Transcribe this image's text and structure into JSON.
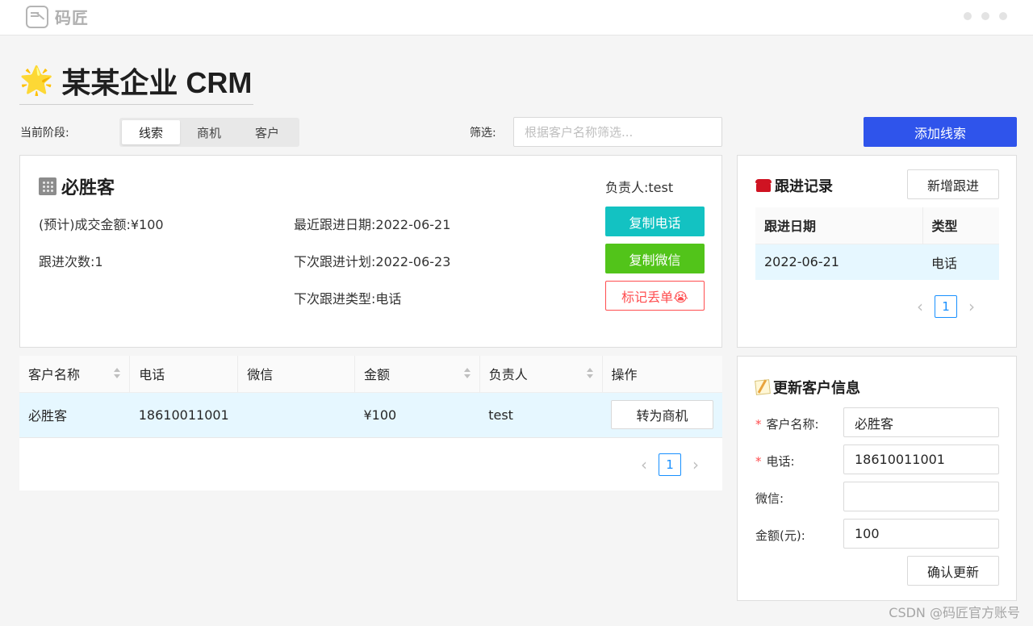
{
  "app": {
    "logo_text": "码匠"
  },
  "page": {
    "title": "某某企业 CRM"
  },
  "stage_filter": {
    "label": "当前阶段:",
    "tabs": [
      {
        "label": "线索",
        "active": true
      },
      {
        "label": "商机",
        "active": false
      },
      {
        "label": "客户",
        "active": false
      }
    ]
  },
  "search": {
    "label": "筛选:",
    "placeholder": "根据客户名称筛选...",
    "value": ""
  },
  "add_lead_button": "添加线索",
  "detail": {
    "company": "必胜客",
    "owner": "负责人:test",
    "expected_amount": "(预计)成交金额:¥100",
    "followup_count": "跟进次数:1",
    "last_followup": "最近跟进日期:2022-06-21",
    "next_plan": "下次跟进计划:2022-06-23",
    "next_type": "下次跟进类型:电话",
    "copy_phone_button": "复制电话",
    "copy_wechat_button": "复制微信",
    "mark_lost_button": "标记丢单😭"
  },
  "main_table": {
    "headers": [
      "客户名称",
      "电话",
      "微信",
      "金额",
      "负责人",
      "操作"
    ],
    "rows": [
      {
        "name": "必胜客",
        "phone": "18610011001",
        "wechat": "",
        "amount": "¥100",
        "owner": "test",
        "action": "转为商机"
      }
    ],
    "pagination": {
      "prev": "‹",
      "page": "1",
      "next": "›"
    }
  },
  "followup": {
    "title": "跟进记录",
    "add_button": "新增跟进",
    "headers": [
      "跟进日期",
      "类型"
    ],
    "rows": [
      {
        "date": "2022-06-21",
        "type": "电话"
      }
    ],
    "pagination": {
      "prev": "‹",
      "page": "1",
      "next": "›"
    }
  },
  "update_form": {
    "title": "更新客户信息",
    "required_mark": "*",
    "fields": {
      "name": {
        "label": "客户名称:",
        "value": "必胜客"
      },
      "phone": {
        "label": "电话:",
        "value": "18610011001"
      },
      "wechat": {
        "label": "微信:",
        "value": ""
      },
      "amount": {
        "label": "金额(元):",
        "value": "100"
      }
    },
    "submit_button": "确认更新"
  },
  "watermark": "CSDN @码匠官方账号",
  "colors": {
    "primary": "#2f54eb",
    "cyan": "#13c2c2",
    "green": "#52c41a",
    "danger": "#ff4d4f",
    "selected_row": "#e6f7ff",
    "page_link": "#1890ff"
  }
}
